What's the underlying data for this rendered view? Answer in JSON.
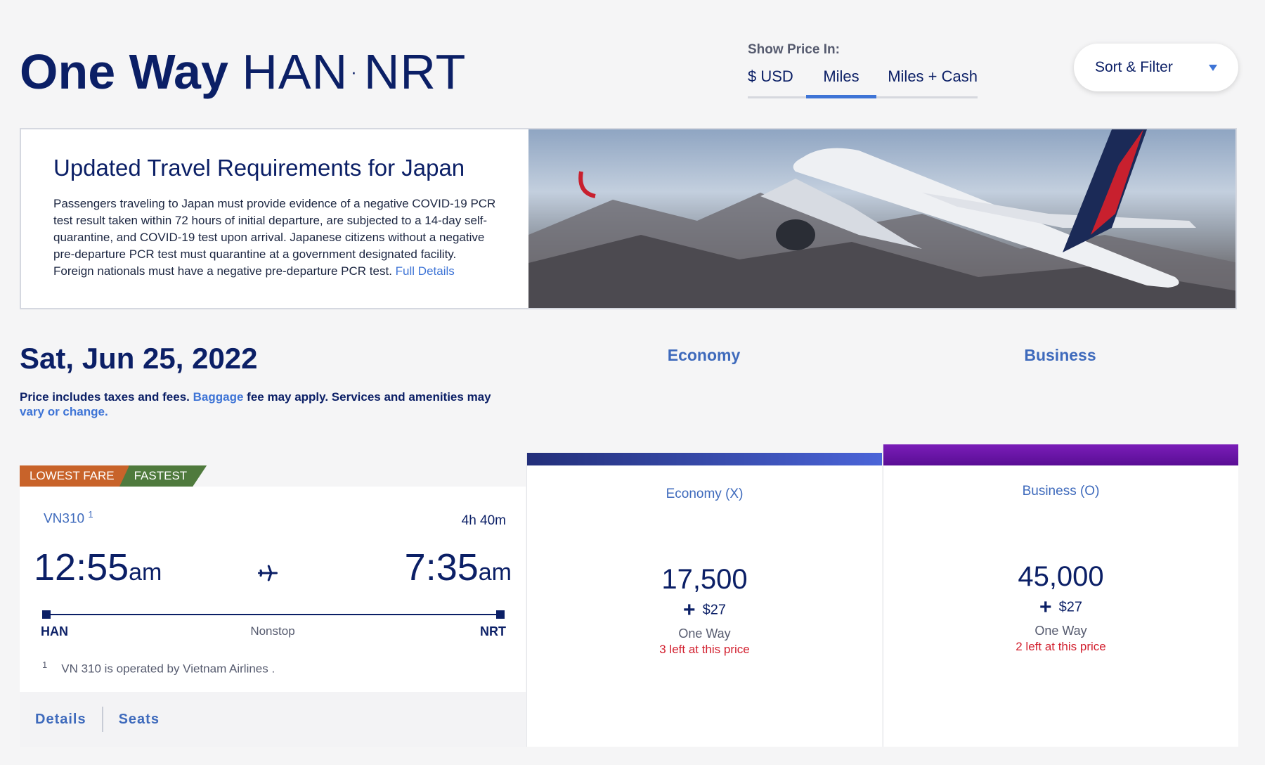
{
  "header": {
    "title_bold": "One Way",
    "origin": "HAN",
    "separator": "·",
    "destination": "NRT"
  },
  "price_toggle": {
    "label": "Show Price In:",
    "options": [
      "$ USD",
      "Miles",
      "Miles + Cash"
    ],
    "selected": "Miles"
  },
  "sort_filter": {
    "label": "Sort & Filter",
    "icon": "caret-down-icon"
  },
  "advisory": {
    "title": "Updated Travel Requirements for Japan",
    "body": "Passengers traveling to Japan must provide evidence of a negative COVID-19 PCR test result taken within 72 hours of initial departure, are subjected to a 14-day self-quarantine, and COVID-19 test upon arrival. Japanese citizens without a negative pre-departure PCR test must quarantine at a government designated facility. Foreign nationals must have a negative pre-departure PCR test.",
    "link": "Full Details"
  },
  "results": {
    "date": "Sat, Jun 25, 2022",
    "note_prefix": "Price includes taxes and fees.",
    "note_link1": "Baggage",
    "note_mid": "fee may apply. Services and amenities may",
    "note_link2": "vary or change."
  },
  "cabins": [
    "Economy",
    "Business"
  ],
  "flight": {
    "badges": [
      "LOWEST FARE",
      "FASTEST"
    ],
    "number": "VN310",
    "footnote_marker": "1",
    "duration": "4h 40m",
    "depart_time": "12:55",
    "depart_ampm": "am",
    "arrive_time": "7:35",
    "arrive_ampm": "am",
    "origin": "HAN",
    "destination": "NRT",
    "stops": "Nonstop",
    "footnote": "VN 310 is operated by Vietnam Airlines .",
    "actions": [
      "Details",
      "Seats"
    ]
  },
  "fares": [
    {
      "class": "Economy (X)",
      "miles": "17,500",
      "cash": "$27",
      "trip": "One Way",
      "availability": "3 left at this price"
    },
    {
      "class": "Business (O)",
      "miles": "45,000",
      "cash": "$27",
      "trip": "One Way",
      "availability": "2 left at this price"
    }
  ],
  "colors": {
    "navy": "#0b1f66",
    "accent": "#3e74d6",
    "alert": "#d21f2e",
    "economy_bar": "#3b4fbf",
    "business_bar": "#6a14a8",
    "badge_lowest": "#c8632a",
    "badge_fastest": "#4f7a3d"
  }
}
